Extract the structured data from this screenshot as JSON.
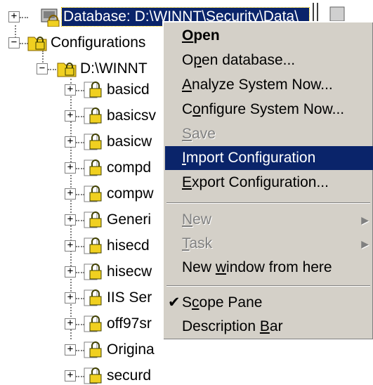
{
  "tree": {
    "root": {
      "label": "Database: D:\\WINNT\\Security\\Data\\"
    },
    "configurations": {
      "label": "Configurations"
    },
    "folder": {
      "label": "D:\\WINNT"
    },
    "templates": [
      {
        "label": "basicd"
      },
      {
        "label": "basicsv"
      },
      {
        "label": "basicw"
      },
      {
        "label": "compd"
      },
      {
        "label": "compw"
      },
      {
        "label": "Generi"
      },
      {
        "label": "hisecd"
      },
      {
        "label": "hisecw"
      },
      {
        "label": "IIS Ser"
      },
      {
        "label": "off97sr"
      },
      {
        "label": "Origina"
      },
      {
        "label": "securd"
      }
    ],
    "expand_glyph": "+",
    "collapse_glyph": "−"
  },
  "menu": {
    "open": {
      "pre": "",
      "u": "O",
      "post": "pen"
    },
    "open_database": {
      "pre": "O",
      "u": "p",
      "post": "en database..."
    },
    "analyze": {
      "pre": "",
      "u": "A",
      "post": "nalyze System Now..."
    },
    "configure": {
      "pre": "C",
      "u": "o",
      "post": "nfigure System Now..."
    },
    "save": {
      "pre": "",
      "u": "S",
      "post": "ave"
    },
    "import": {
      "pre": "",
      "u": "I",
      "post": "mport Configuration"
    },
    "export": {
      "pre": "",
      "u": "E",
      "post": "xport Configuration..."
    },
    "new": {
      "pre": "",
      "u": "N",
      "post": "ew"
    },
    "task": {
      "pre": "",
      "u": "T",
      "post": "ask"
    },
    "new_window": {
      "pre": "New ",
      "u": "w",
      "post": "indow from here"
    },
    "scope_pane": {
      "pre": "S",
      "u": "c",
      "post": "ope Pane"
    },
    "description_bar": {
      "pre": "Description ",
      "u": "B",
      "post": "ar"
    },
    "check_mark": "✔",
    "submenu_arrow": "▶"
  },
  "colors": {
    "highlight": "#0a246a",
    "menu_bg": "#d4d0c8",
    "disabled": "#808080",
    "lock_yellow": "#f0d020"
  }
}
